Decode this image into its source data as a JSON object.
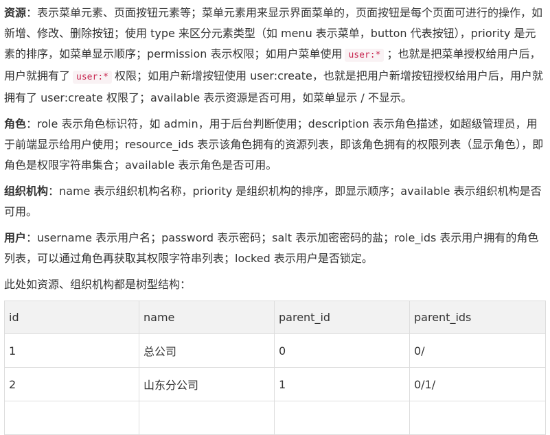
{
  "p1": {
    "label": "资源",
    "text1": "：表示菜单元素、页面按钮元素等；菜单元素用来显示界面菜单的，页面按钮是每个页面可进行的操作，如新增、修改、删除按钮；使用 type 来区分元素类型（如 menu 表示菜单，button 代表按钮），priority 是元素的排序，如菜单显示顺序；permission 表示权限；如用户菜单使用",
    "code1": "user:*",
    "text2": "；也就是把菜单授权给用户后，用户就拥有了",
    "code2": "user:*",
    "text3": "权限；如用户新增按钮使用 user:create，也就是把用户新增按钮授权给用户后，用户就拥有了 user:create 权限了；available 表示资源是否可用，如菜单显示 / 不显示。"
  },
  "p2": {
    "label": "角色",
    "text": "：role 表示角色标识符，如 admin，用于后台判断使用；description 表示角色描述，如超级管理员，用于前端显示给用户使用；resource_ids 表示该角色拥有的资源列表，即该角色拥有的权限列表（显示角色），即角色是权限字符串集合；available 表示角色是否可用。"
  },
  "p3": {
    "label": "组织机构",
    "text": "：name 表示组织机构名称，priority 是组织机构的排序，即显示顺序；available 表示组织机构是否可用。"
  },
  "p4": {
    "label": "用户",
    "text": "：username 表示用户名；password 表示密码；salt 表示加密密码的盐；role_ids 表示用户拥有的角色列表，可以通过角色再获取其权限字符串列表；locked 表示用户是否锁定。"
  },
  "p5": {
    "text": "此处如资源、组织机构都是树型结构："
  },
  "table": {
    "headers": [
      "id",
      "name",
      "parent_id",
      "parent_ids"
    ],
    "rows": [
      [
        "1",
        "总公司",
        "0",
        "0/"
      ],
      [
        "2",
        "山东分公司",
        "1",
        "0/1/"
      ],
      [
        "",
        "",
        "",
        ""
      ]
    ]
  },
  "colors": {
    "code_text": "#c7254e",
    "code_bg": "#f9f2f4",
    "header_bg": "#f2f2f2",
    "border": "#dddddd"
  }
}
